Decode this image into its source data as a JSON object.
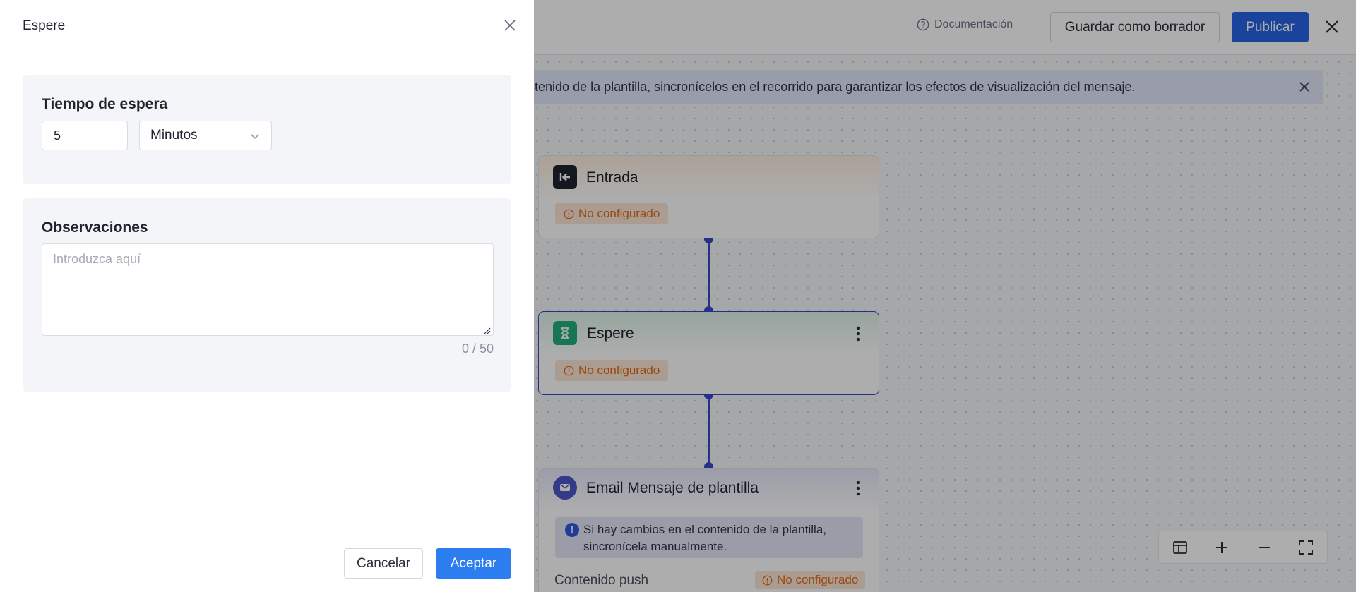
{
  "topbar": {
    "documentation": "Documentación",
    "save_draft": "Guardar como borrador",
    "publish": "Publicar"
  },
  "banner": {
    "text": "ontenido de la plantilla, sincronícelos en el recorrido para garantizar los efectos de visualización del mensaje."
  },
  "nodes": [
    {
      "title": "Entrada",
      "status": "No configurado",
      "icon": "entry-arrow-icon",
      "color": "#1f2330"
    },
    {
      "title": "Espere",
      "status": "No configurado",
      "icon": "hourglass-icon",
      "color": "#22b07d"
    },
    {
      "title": "Email Mensaje de plantilla",
      "icon": "mail-icon",
      "color": "#4d56c9",
      "info": "Si hay cambios en el contenido de la plantilla, sincronícela manualmente.",
      "push_label": "Contenido push",
      "push_status": "No configurado"
    }
  ],
  "drawer": {
    "title": "Espere",
    "wait_label": "Tiempo de espera",
    "wait_value": "5",
    "unit": "Minutos",
    "notes_label": "Observaciones",
    "notes_placeholder": "Introduzca aquí",
    "counter": "0 / 50",
    "cancel": "Cancelar",
    "accept": "Aceptar"
  },
  "colors": {
    "primary": "#2b7df0",
    "publish": "#2764e6",
    "connector": "#3b46c9",
    "warning": "#e06a18"
  }
}
